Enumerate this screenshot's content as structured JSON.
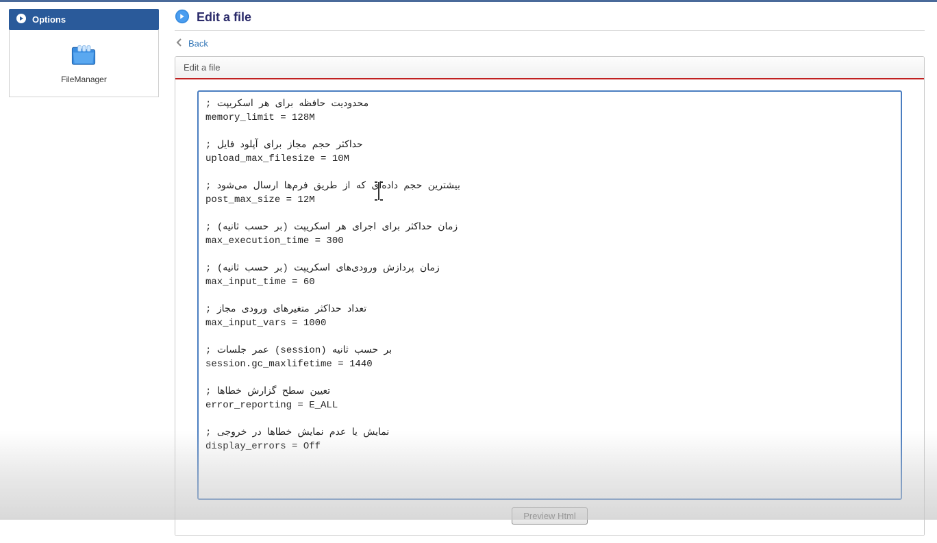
{
  "sidebar": {
    "options_label": "Options",
    "file_manager_label": "FileManager"
  },
  "main": {
    "title": "Edit a file",
    "back_label": "Back",
    "panel_title": "Edit a file",
    "editor_content": "; محدودیت حافظه برای هر اسکریپت\nmemory_limit = 128M\n\n; حداکثر حجم مجاز برای آپلود فایل\nupload_max_filesize = 10M\n\n; بیشترین حجم داده‌ای که از طریق فرم‌ها ارسال می‌شود\npost_max_size = 12M\n\n; زمان حداکثر برای اجرای هر اسکریپت (بر حسب ثانیه)\nmax_execution_time = 300\n\n; زمان پردازش ورودی‌های اسکریپت (بر حسب ثانیه)\nmax_input_time = 60\n\n; تعداد حداکثر متغیرهای ورودی مجاز\nmax_input_vars = 1000\n\n; عمر جلسات (session) بر حسب ثانیه\nsession.gc_maxlifetime = 1440\n\n; تعیین سطح گزارش خطاها\nerror_reporting = E_ALL\n\n; نمایش یا عدم نمایش خطاها در خروجی\ndisplay_errors = Off",
    "preview_button_label": "Preview Html"
  }
}
